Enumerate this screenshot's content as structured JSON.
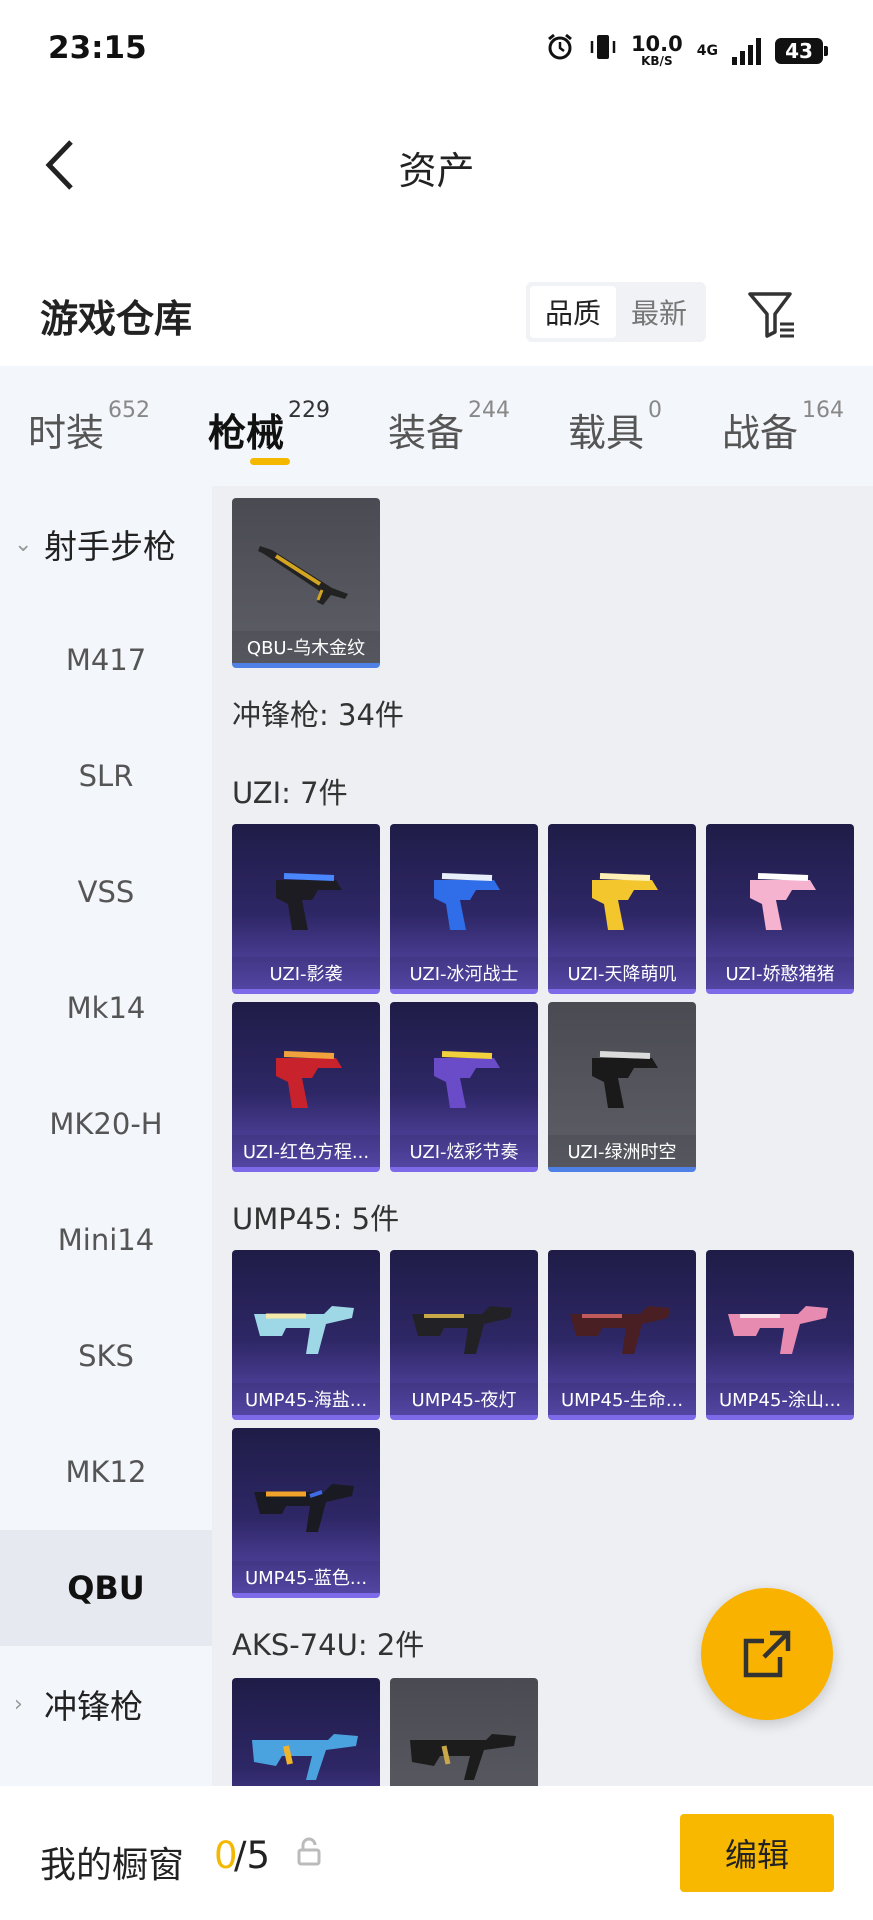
{
  "status": {
    "time": "23:15",
    "net_speed": "10.0",
    "net_unit": "KB/S",
    "net_type": "4G",
    "battery": "43"
  },
  "header": {
    "title": "资产"
  },
  "warehouse": {
    "title": "游戏仓库",
    "sort_quality": "品质",
    "sort_newest": "最新"
  },
  "tabs": [
    {
      "label": "时装",
      "count": "652"
    },
    {
      "label": "枪械",
      "count": "229"
    },
    {
      "label": "装备",
      "count": "244"
    },
    {
      "label": "载具",
      "count": "0"
    },
    {
      "label": "战备",
      "count": "164"
    }
  ],
  "sidebar": {
    "group1": "射手步枪",
    "items": [
      "M417",
      "SLR",
      "VSS",
      "Mk14",
      "MK20-H",
      "Mini14",
      "SKS",
      "MK12",
      "QBU"
    ],
    "group2": "冲锋枪"
  },
  "content": {
    "qbu_items": [
      "QBU-乌木金纹"
    ],
    "smg_header": "冲锋枪: 34件",
    "uzi_header": "UZI: 7件",
    "uzi_items": [
      "UZI-影袭",
      "UZI-冰河战士",
      "UZI-天降萌叽",
      "UZI-娇憨猪猪",
      "UZI-红色方程...",
      "UZI-炫彩节奏",
      "UZI-绿洲时空"
    ],
    "ump_header": "UMP45: 5件",
    "ump_items": [
      "UMP45-海盐...",
      "UMP45-夜灯",
      "UMP45-生命...",
      "UMP45-涂山...",
      "UMP45-蓝色..."
    ],
    "aks_header": "AKS-74U: 2件"
  },
  "bottom": {
    "window_label": "我的橱窗",
    "used": "0",
    "total": "/5",
    "edit_label": "编辑"
  },
  "colors": {
    "accent": "#f9b800",
    "purple_card": "#2e2766",
    "grey_card": "#55565d",
    "sidebar_bg": "#f3f6fb"
  }
}
